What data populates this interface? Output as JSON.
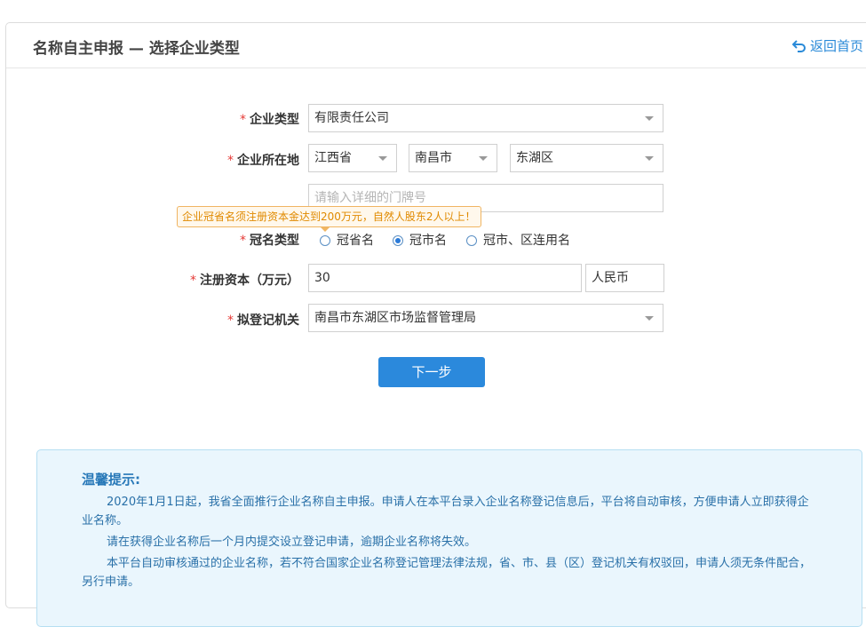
{
  "header": {
    "title": "名称自主申报 — 选择企业类型",
    "back_label": "返回首页"
  },
  "form": {
    "company_type": {
      "label": "企业类型",
      "value": "有限责任公司"
    },
    "location": {
      "label": "企业所在地",
      "province": "江西省",
      "city": "南昌市",
      "district": "东湖区",
      "address_placeholder": "请输入详细的门牌号"
    },
    "tooltip": "企业冠省名须注册资本金达到200万元，自然人股东2人以上！",
    "crown_type": {
      "label": "冠名类型",
      "options": [
        {
          "label": "冠省名",
          "checked": false
        },
        {
          "label": "冠市名",
          "checked": true
        },
        {
          "label": "冠市、区连用名",
          "checked": false
        }
      ]
    },
    "capital": {
      "label": "注册资本（万元）",
      "value": "30",
      "currency": "人民币"
    },
    "authority": {
      "label": "拟登记机关",
      "value": "南昌市东湖区市场监督管理局"
    },
    "required_mark": "*",
    "next_label": "下一步"
  },
  "tips": {
    "title": "温馨提示:",
    "p1": "2020年1月1日起，我省全面推行企业名称自主申报。申请人在本平台录入企业名称登记信息后，平台将自动审核，方便申请人立即获得企业名称。",
    "p2": "请在获得企业名称后一个月内提交设立登记申请，逾期企业名称将失效。",
    "p3": "本平台自动审核通过的企业名称，若不符合国家企业名称登记管理法律法规，省、市、县（区）登记机关有权驳回，申请人须无条件配合，另行申请。"
  },
  "colors": {
    "accent": "#2b89dc",
    "required": "#e53935",
    "tooltip": "#e08a00",
    "tips_bg": "#eaf6fd"
  }
}
